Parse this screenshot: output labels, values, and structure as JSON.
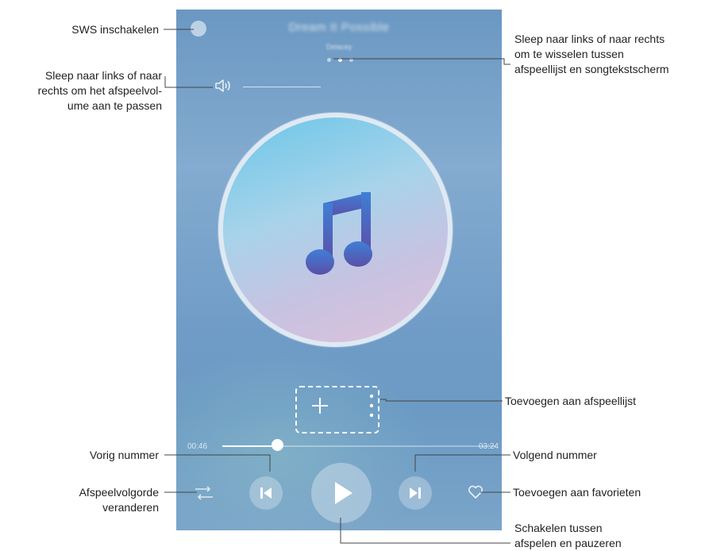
{
  "player": {
    "song_title": "Dream It Possible",
    "artist": "Delacey",
    "current_time": "00:46",
    "total_time": "03:24",
    "progress": 0.2,
    "page_indicator": {
      "count": 3,
      "active_index": 1
    },
    "colors": {
      "accent": "#ffffff",
      "background_top": "#6a98c2",
      "background_bottom": "#7ba5c9"
    },
    "icons": {
      "sws": "sws-toggle-icon",
      "volume": "speaker-icon",
      "album": "music-note-icon",
      "add": "plus-icon",
      "more": "vertical-dots-icon",
      "shuffle": "shuffle-icon",
      "previous": "skip-previous-icon",
      "play": "play-icon",
      "next": "skip-next-icon",
      "favorite": "heart-icon"
    }
  },
  "callouts": {
    "sws": "SWS inschakelen",
    "swipe_pages": [
      "Sleep naar links of naar rechts",
      "om te wisselen tussen",
      "afspeellijst en songtekstscherm"
    ],
    "volume": [
      "Sleep naar links of naar",
      "rechts om het afspeelvol-",
      "ume aan te passen"
    ],
    "add_playlist": "Toevoegen aan afspeellijst",
    "previous": "Vorig nummer",
    "next": "Volgend nummer",
    "order": [
      "Afspeelvolgorde",
      "veranderen"
    ],
    "favorites": "Toevoegen aan favorieten",
    "play_pause": [
      "Schakelen tussen",
      "afspelen en pauzeren"
    ]
  }
}
